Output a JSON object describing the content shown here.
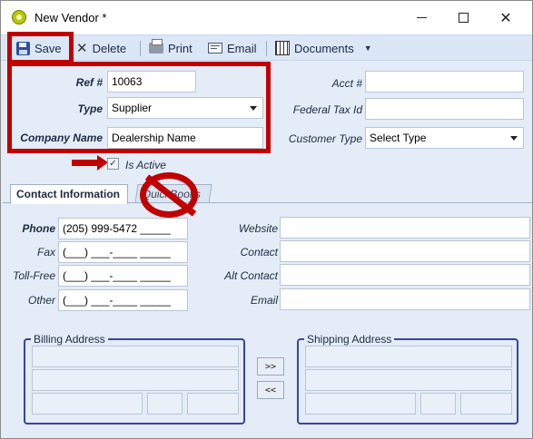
{
  "window": {
    "title": "New Vendor *",
    "controls": {
      "minimize": "minimize-icon",
      "maximize": "maximize-icon",
      "close": "✕"
    }
  },
  "toolbar": {
    "save": "Save",
    "delete": "Delete",
    "print": "Print",
    "email": "Email",
    "documents": "Documents"
  },
  "form": {
    "ref_label": "Ref #",
    "ref_value": "10063",
    "type_label": "Type",
    "type_value": "Supplier",
    "company_label": "Company Name",
    "company_value": "Dealership Name",
    "acct_label": "Acct #",
    "acct_value": "",
    "federal_label": "Federal Tax Id",
    "federal_value": "",
    "customer_type_label": "Customer Type",
    "customer_type_value": "Select Type",
    "is_active_label": "Is Active",
    "is_active_checked": true
  },
  "tabs": [
    {
      "label": "Contact Information",
      "active": true
    },
    {
      "label": "QuickBooks",
      "active": false
    }
  ],
  "contact": {
    "phone_label": "Phone",
    "phone_value": "(205) 999-5472 _____",
    "fax_label": "Fax",
    "fax_value": "(___) ___-____ _____",
    "tollfree_label": "Toll-Free",
    "tollfree_value": "(___) ___-____ _____",
    "other_label": "Other",
    "other_value": "(___) ___-____ _____",
    "website_label": "Website",
    "contact_label": "Contact",
    "alt_contact_label": "Alt Contact",
    "email_label": "Email"
  },
  "addresses": {
    "billing_title": "Billing Address",
    "shipping_title": "Shipping Address",
    "copy_right": ">>",
    "copy_left": "<<"
  },
  "colors": {
    "annotation_red": "#c00000",
    "toolbar_bg": "#dbe7f7",
    "form_bg": "#e4ecf7",
    "group_border": "#3644a8"
  }
}
